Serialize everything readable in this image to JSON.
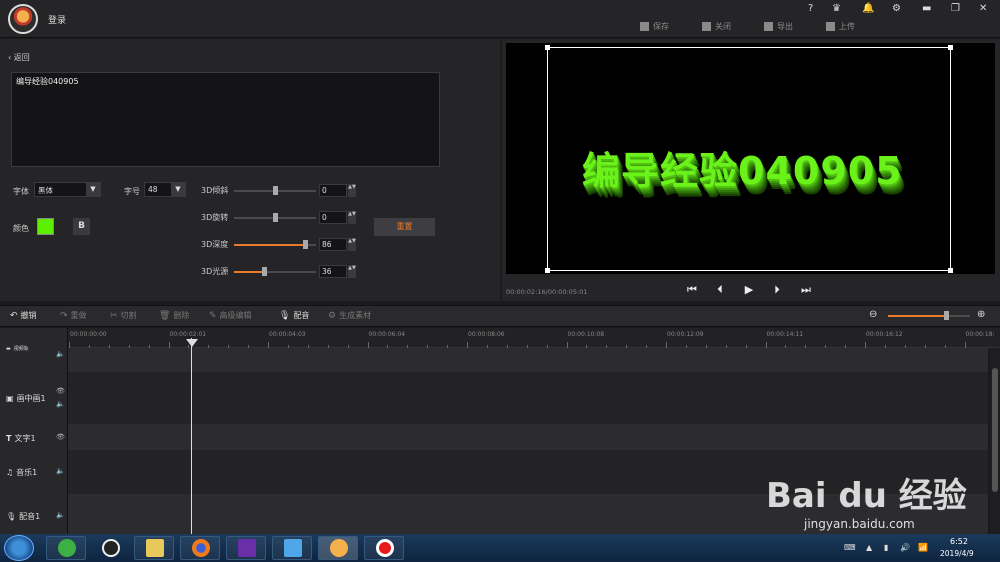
{
  "topbar": {
    "login": "登录",
    "icons": [
      "?",
      "vip-icon",
      "bell-icon",
      "gear-icon",
      "minimize-icon",
      "restore-icon",
      "close-icon"
    ],
    "actions": [
      {
        "label": "保存",
        "icon": "save-icon"
      },
      {
        "label": "关闭",
        "icon": "exit-icon"
      },
      {
        "label": "导出",
        "icon": "export-icon"
      },
      {
        "label": "上传",
        "icon": "upload-icon"
      }
    ]
  },
  "editor": {
    "back": "返回",
    "text_value": "编导经验040905",
    "font_label": "字体",
    "font_value": "黑体",
    "size_label": "字号",
    "size_value": "48",
    "color_label": "颜色",
    "color_value": "#5cf000",
    "bold_label": "B",
    "reset_label": "重置",
    "sliders": [
      {
        "label": "3D倾斜",
        "value": "0",
        "fraction": 0.5,
        "active": false
      },
      {
        "label": "3D旋转",
        "value": "0",
        "fraction": 0.5,
        "active": false
      },
      {
        "label": "3D深度",
        "value": "86",
        "fraction": 0.86,
        "active": true
      },
      {
        "label": "3D光源",
        "value": "36",
        "fraction": 0.36,
        "active": true
      }
    ]
  },
  "preview": {
    "text": "编导经验040905",
    "timecode": "00:00:02:16/00:00:05:01",
    "controls": [
      "skip-start-icon",
      "step-back-icon",
      "play-icon",
      "step-forward-icon",
      "skip-end-icon"
    ]
  },
  "toolbar": {
    "items": [
      {
        "label": "撤销",
        "icon": "undo-icon",
        "enabled": true
      },
      {
        "label": "重做",
        "icon": "redo-icon",
        "enabled": false
      },
      {
        "label": "切割",
        "icon": "scissors-icon",
        "enabled": false
      },
      {
        "label": "删除",
        "icon": "trash-icon",
        "enabled": false
      },
      {
        "label": "高级编辑",
        "icon": "edit-icon",
        "enabled": false
      },
      {
        "label": "配音",
        "icon": "mic-icon",
        "enabled": true
      },
      {
        "label": "生成素材",
        "icon": "gear-icon",
        "enabled": false
      }
    ],
    "zoom_fraction": 0.7
  },
  "timeline": {
    "ruler": [
      "00:00:00:00",
      "00:00:02:01",
      "00:00:04:03",
      "00:00:06:04",
      "00:00:08:06",
      "00:00:10:08",
      "00:00:12:09",
      "00:00:14:11",
      "00:00:16:12",
      "00:00:18:"
    ],
    "tracks": [
      {
        "label": "视频轨",
        "icon": "video-icon"
      },
      {
        "label": "画中画1",
        "icon": "pip-icon"
      },
      {
        "label": "文字1",
        "icon": "text-icon"
      },
      {
        "label": "音乐1",
        "icon": "music-icon"
      },
      {
        "label": "配音1",
        "icon": "mic-icon"
      }
    ]
  },
  "taskbar": {
    "time": "6:52",
    "date": "2019/4/9"
  },
  "watermark": {
    "logo": "Bai  du 经验",
    "url": "jingyan.baidu.com"
  }
}
